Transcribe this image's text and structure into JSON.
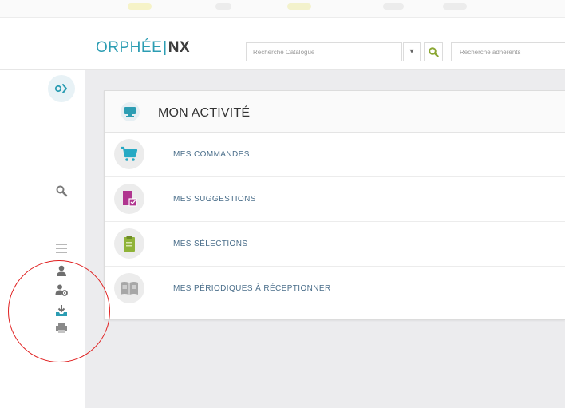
{
  "app": {
    "logo_part1": "ORPHÉE",
    "logo_separator": "|",
    "logo_part2": "NX"
  },
  "header": {
    "catalog_search_placeholder": "Recherche Catalogue",
    "catalog_dropdown_glyph": "▾",
    "members_search_placeholder": "Recherche adhérents"
  },
  "sidebar": {
    "icons": [
      "toggle-panel-icon",
      "search-icon",
      "list-icon",
      "user-icon",
      "user-settings-icon",
      "inbox-download-icon",
      "printer-icon"
    ]
  },
  "activity": {
    "title": "MON ACTIVITÉ",
    "items": [
      {
        "label": "MES COMMANDES",
        "icon": "cart-icon",
        "color": "#26a9c4"
      },
      {
        "label": "MES SUGGESTIONS",
        "icon": "suggestion-book-icon",
        "color": "#b0358f"
      },
      {
        "label": "MES SÉLECTIONS",
        "icon": "clipboard-icon",
        "color": "#8fb338"
      },
      {
        "label": "MES PÉRIODIQUES À RÉCEPTIONNER",
        "icon": "open-book-icon",
        "color": "#a7a7a7"
      }
    ]
  },
  "colors": {
    "accent": "#2c9db3",
    "annotation": "#e02020"
  }
}
